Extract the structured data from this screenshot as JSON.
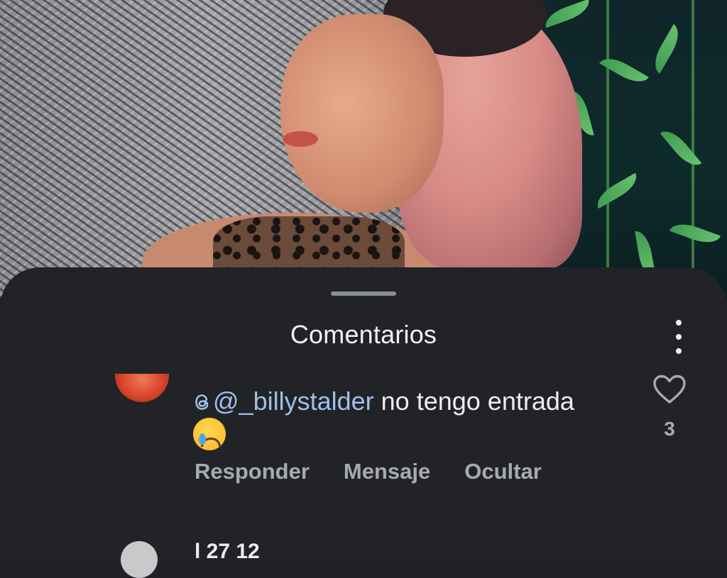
{
  "sheet": {
    "title": "Comentarios",
    "more_icon": "more-vert-icon"
  },
  "comment": {
    "username": "@_billystalder",
    "username_icon": "threads-icon",
    "text": "no tengo entrada",
    "emoji": "crying-face-emoji",
    "like_icon": "heart-outline-icon",
    "like_count": "3",
    "actions": {
      "reply": "Responder",
      "message": "Mensaje",
      "hide": "Ocultar"
    }
  },
  "next_comment": {
    "partial_text": "l     27   12 "
  },
  "colors": {
    "sheet_background": "#212326",
    "mention": "#9fc0ea",
    "muted_text": "#a7aab0"
  }
}
